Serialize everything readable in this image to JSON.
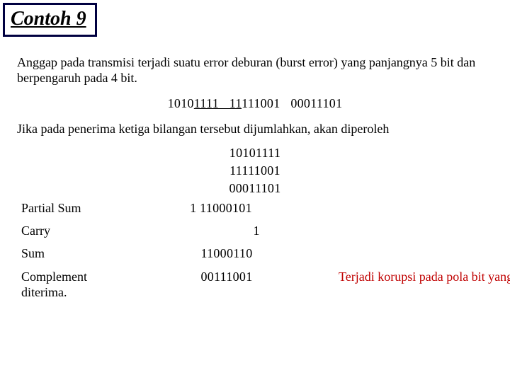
{
  "title": "Contoh 9",
  "paragraph1": "Anggap pada transmisi terjadi suatu error deburan (burst error) yang panjangnya 5 bit dan berpengaruh pada 4 bit.",
  "three_words": {
    "w1_plain": "1010",
    "w1_ul": "1111   11",
    "w1_tail": "111001   00011101"
  },
  "paragraph2": "Jika pada penerima ketiga bilangan tersebut dijumlahkan, akan diperoleh",
  "stack": [
    "10101111",
    "11111001",
    "00011101"
  ],
  "rows": {
    "partial_sum": {
      "label": "Partial Sum",
      "value": "1 11000101"
    },
    "carry": {
      "label": "Carry",
      "value": "1"
    },
    "sum": {
      "label": "Sum",
      "value": "11000110"
    },
    "complement": {
      "label_l1": "Complement",
      "label_l2": "diterima.",
      "value": "00111001",
      "note": "Terjadi korupsi pada pola bit yang"
    }
  }
}
